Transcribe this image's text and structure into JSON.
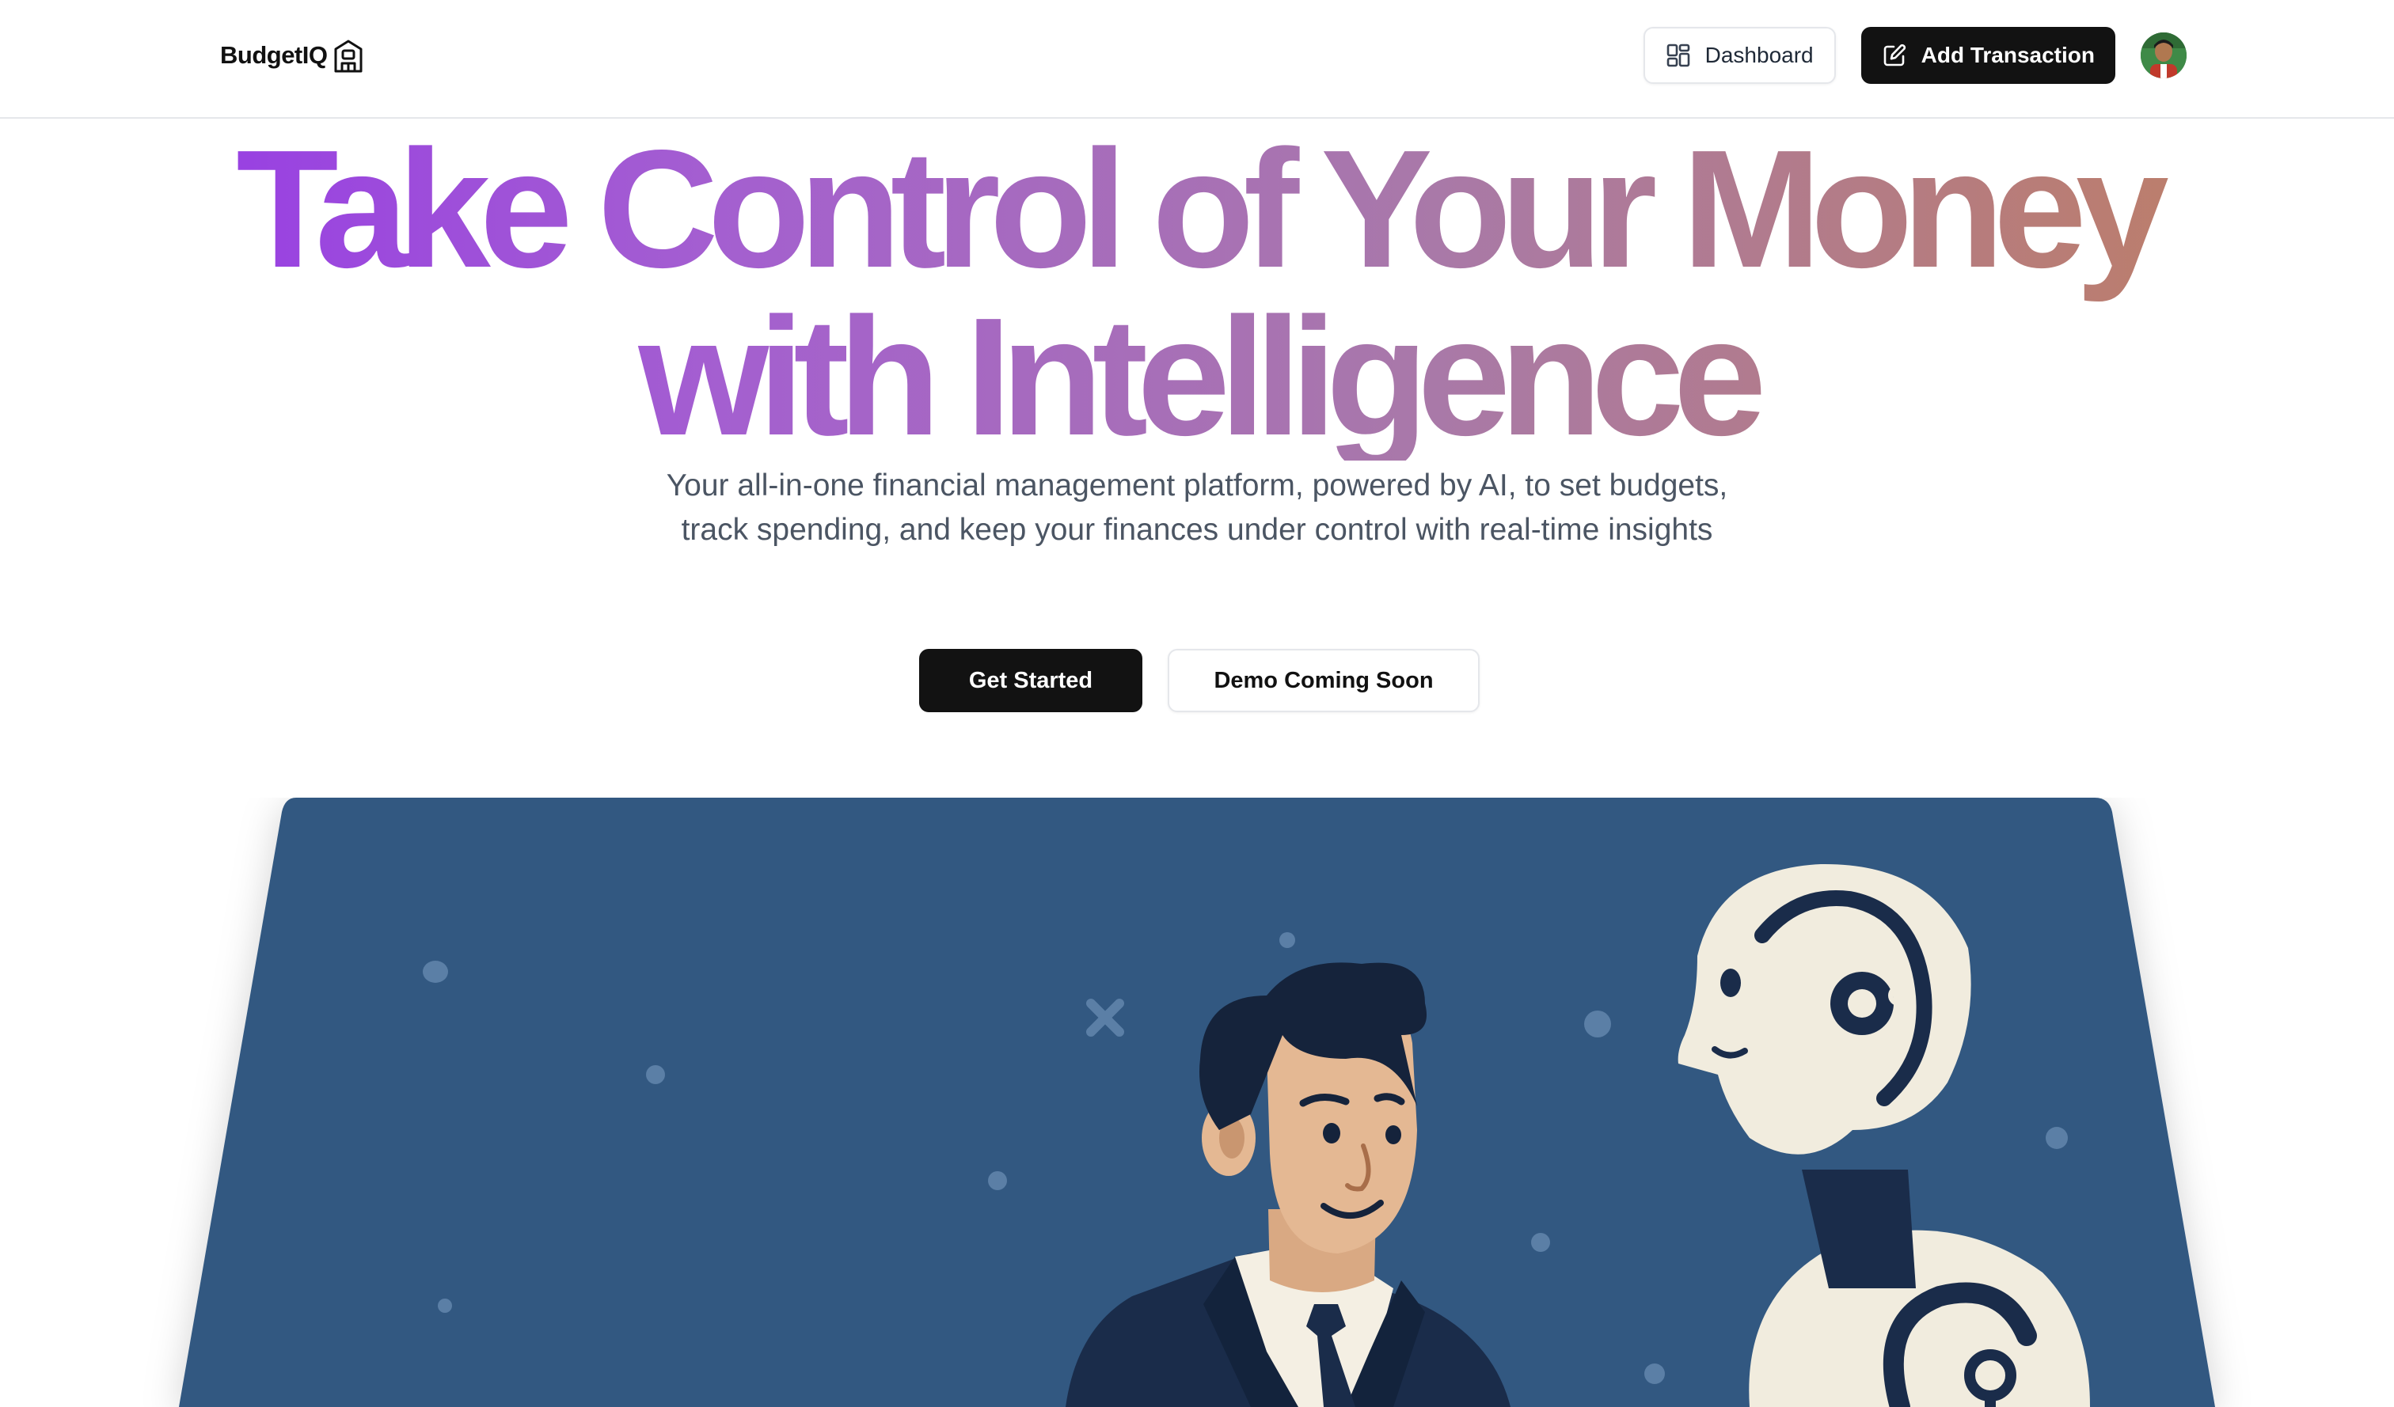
{
  "header": {
    "logo_text": "BudgetIQ",
    "logo_icon": "building-icon",
    "dashboard_label": "Dashboard",
    "dashboard_icon": "grid-icon",
    "add_transaction_label": "Add Transaction",
    "add_transaction_icon": "pen-square-icon"
  },
  "hero": {
    "title_line1": "Take Control of Your Money",
    "title_line2": "with Intelligence",
    "subtitle": "Your all-in-one financial management platform, powered by AI, to set budgets, track spending, and keep your finances under control with real-time insights",
    "get_started_label": "Get Started",
    "demo_label": "Demo Coming Soon"
  },
  "colors": {
    "gradient_start": "#9333ea",
    "gradient_end": "#c17f5b",
    "card_background": "#335981",
    "dark_button": "#121212"
  }
}
